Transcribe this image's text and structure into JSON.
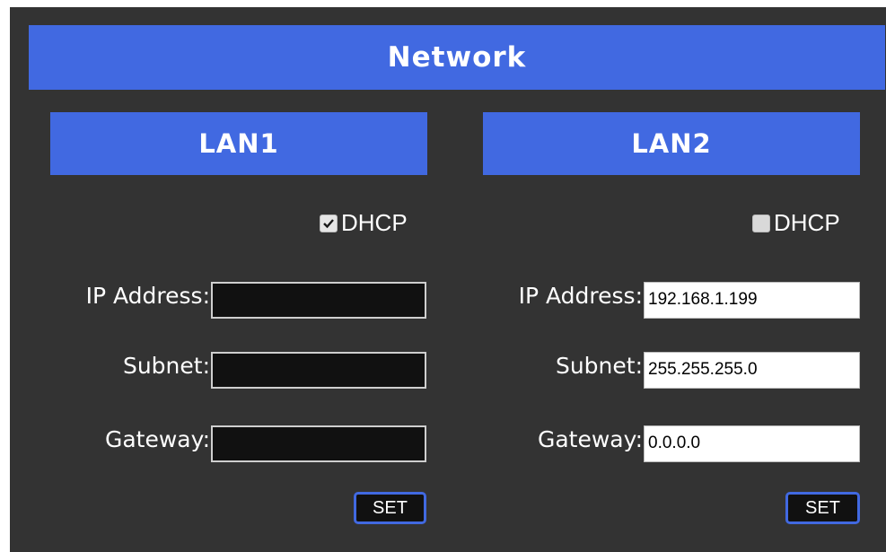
{
  "title": "Network",
  "colors": {
    "accent": "#4169e1",
    "panel_bg": "#333333",
    "dark_field_bg": "#111111"
  },
  "lan1": {
    "header": "LAN1",
    "dhcp_label": "DHCP",
    "dhcp_checked": true,
    "ip_label": "IP Address:",
    "ip_value": "",
    "subnet_label": "Subnet:",
    "subnet_value": "",
    "gateway_label": "Gateway:",
    "gateway_value": "",
    "set_label": "SET"
  },
  "lan2": {
    "header": "LAN2",
    "dhcp_label": "DHCP",
    "dhcp_checked": false,
    "ip_label": "IP Address:",
    "ip_value": "192.168.1.199",
    "subnet_label": "Subnet:",
    "subnet_value": "255.255.255.0",
    "gateway_label": "Gateway:",
    "gateway_value": "0.0.0.0",
    "set_label": "SET"
  }
}
